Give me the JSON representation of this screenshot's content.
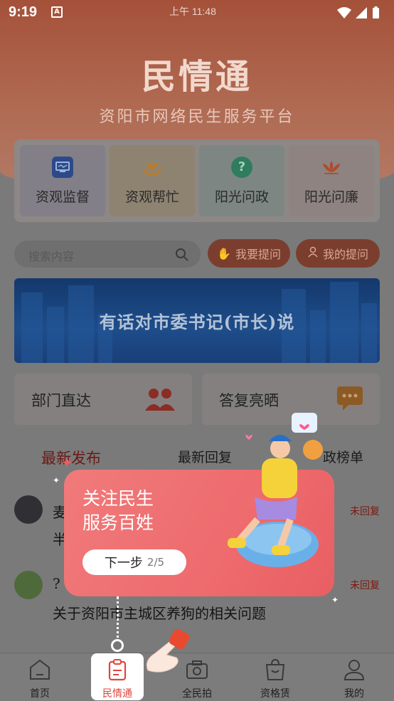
{
  "status_bar": {
    "time": "9:19",
    "center_time": "上午 11:48",
    "keyboard_badge": "A"
  },
  "header": {
    "title": "民情通",
    "subtitle": "资阳市网络民生服务平台"
  },
  "categories": [
    {
      "label": "资观监督",
      "icon": "monitor-icon",
      "bg": "#827f88",
      "icon_color": "#2c4a8a"
    },
    {
      "label": "资观帮忙",
      "icon": "heart-hands-icon",
      "bg": "#8e8370",
      "icon_color": "#c07a22"
    },
    {
      "label": "阳光问政",
      "icon": "question-bubble-icon",
      "bg": "#7d8683",
      "icon_color": "#2f7c5f"
    },
    {
      "label": "阳光问廉",
      "icon": "lotus-icon",
      "bg": "#8e8380",
      "icon_color": "#b04a2a"
    }
  ],
  "search": {
    "placeholder": "搜索内容"
  },
  "actions": {
    "ask": "我要提问",
    "my_questions": "我的提问"
  },
  "banner": {
    "text": "有话对市委书记(市长)说"
  },
  "quick_links": {
    "dept": "部门直达",
    "answers": "答复亮晒"
  },
  "tabs": [
    "最新发布",
    "最新回复",
    "政榜单"
  ],
  "feed": [
    {
      "title_start": "麦",
      "line2": "半",
      "status": "未回复"
    },
    {
      "title_start": "?",
      "line2": "关于资阳市主城区养狗的相关问题",
      "status": "未回复"
    }
  ],
  "guide_popup": {
    "line1": "关注民生",
    "line2": "服务百姓",
    "next": "下一步",
    "step": "2/5"
  },
  "bottom_nav": [
    {
      "label": "首页",
      "icon": "home-icon"
    },
    {
      "label": "民情通",
      "icon": "clipboard-icon",
      "active": true
    },
    {
      "label": "全民拍",
      "icon": "camera-icon"
    },
    {
      "label": "资格赁",
      "icon": "bag-icon"
    },
    {
      "label": "我的",
      "icon": "user-icon"
    }
  ],
  "colors": {
    "accent": "#e0453d",
    "popup": "#ee6b6e",
    "hero": "#a5513a"
  }
}
